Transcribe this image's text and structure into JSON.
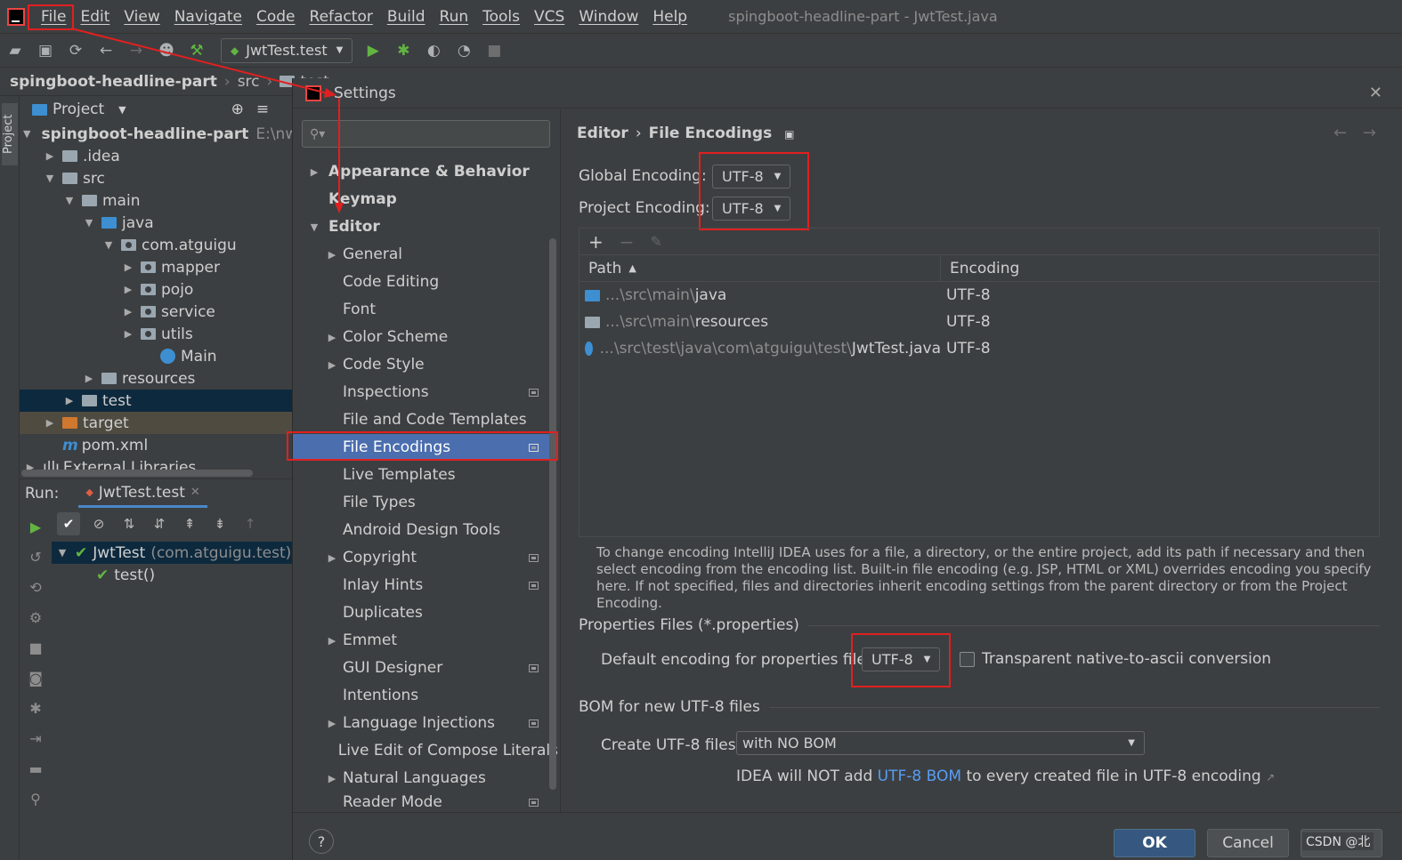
{
  "menubar": {
    "items": [
      "File",
      "Edit",
      "View",
      "Navigate",
      "Code",
      "Refactor",
      "Build",
      "Run",
      "Tools",
      "VCS",
      "Window",
      "Help"
    ],
    "window_title": "spingboot-headline-part - JwtTest.java"
  },
  "toolbar": {
    "run_config": "JwtTest.test"
  },
  "breadcrumb": {
    "project": "spingboot-headline-part",
    "items": [
      "src",
      "test"
    ]
  },
  "left_strip": {
    "tab": "Project"
  },
  "project_panel": {
    "title": "Project",
    "tree": [
      {
        "label": "spingboot-headline-part",
        "path_hint": "E:\\nw",
        "icon": "module-folder-icon"
      },
      {
        "label": ".idea"
      },
      {
        "label": "src"
      },
      {
        "label": "main"
      },
      {
        "label": "java"
      },
      {
        "label": "com.atguigu"
      },
      {
        "label": "mapper"
      },
      {
        "label": "pojo"
      },
      {
        "label": "service"
      },
      {
        "label": "utils"
      },
      {
        "label": "Main"
      },
      {
        "label": "resources"
      },
      {
        "label": "test"
      },
      {
        "label": "target"
      },
      {
        "label": "pom.xml"
      },
      {
        "label": "External Libraries"
      }
    ]
  },
  "run_panel": {
    "label": "Run:",
    "tab": "JwtTest.test",
    "tests": [
      {
        "name": "JwtTest",
        "pkg": "(com.atguigu.test)"
      },
      {
        "name": "test()"
      }
    ]
  },
  "dialog": {
    "title": "Settings",
    "search_placeholder": "",
    "nav": [
      {
        "label": "Appearance & Behavior"
      },
      {
        "label": "Keymap"
      },
      {
        "label": "Editor"
      },
      {
        "label": "General"
      },
      {
        "label": "Code Editing"
      },
      {
        "label": "Font"
      },
      {
        "label": "Color Scheme"
      },
      {
        "label": "Code Style"
      },
      {
        "label": "Inspections"
      },
      {
        "label": "File and Code Templates"
      },
      {
        "label": "File Encodings"
      },
      {
        "label": "Live Templates"
      },
      {
        "label": "File Types"
      },
      {
        "label": "Android Design Tools"
      },
      {
        "label": "Copyright"
      },
      {
        "label": "Inlay Hints"
      },
      {
        "label": "Duplicates"
      },
      {
        "label": "Emmet"
      },
      {
        "label": "GUI Designer"
      },
      {
        "label": "Intentions"
      },
      {
        "label": "Language Injections"
      },
      {
        "label": "Live Edit of Compose Literals"
      },
      {
        "label": "Natural Languages"
      },
      {
        "label": "Reader Mode"
      }
    ],
    "content": {
      "crumb": [
        "Editor",
        "File Encodings"
      ],
      "global_label": "Global Encoding:",
      "global_value": "UTF-8",
      "project_label": "Project Encoding:",
      "project_value": "UTF-8",
      "table_headers": [
        "Path",
        "Encoding"
      ],
      "rows": [
        {
          "dim": "...\\src\\main\\",
          "name": "java",
          "encoding": "UTF-8"
        },
        {
          "dim": "...\\src\\main\\",
          "name": "resources",
          "encoding": "UTF-8"
        },
        {
          "dim": "...\\src\\test\\java\\com\\atguigu\\test\\",
          "name": "JwtTest.java",
          "encoding": "UTF-8"
        }
      ],
      "help_text": "To change encoding IntelliJ IDEA uses for a file, a directory, or the entire project, add its path if necessary and then select encoding from the encoding list. Built-in file encoding (e.g. JSP, HTML or XML) overrides encoding you specify here. If not specified, files and directories inherit encoding settings from the parent directory or from the Project Encoding.",
      "properties_section": "Properties Files (*.properties)",
      "properties_label": "Default encoding for properties files:",
      "properties_value": "UTF-8",
      "transparent_label": "Transparent native-to-ascii conversion",
      "bom_section": "BOM for new UTF-8 files",
      "bom_label": "Create UTF-8 files:",
      "bom_value": "with NO BOM",
      "bom_note_pre": "IDEA will NOT add",
      "bom_note_link": "UTF-8 BOM",
      "bom_note_post": "to every created file in UTF-8 encoding"
    },
    "buttons": {
      "help": "?",
      "ok": "OK",
      "cancel": "Cancel"
    },
    "watermark": "CSDN @北"
  },
  "colors": {
    "accent": "#4b6eaf",
    "annotation": "#e02020",
    "link": "#589df6",
    "success": "#62b543"
  }
}
